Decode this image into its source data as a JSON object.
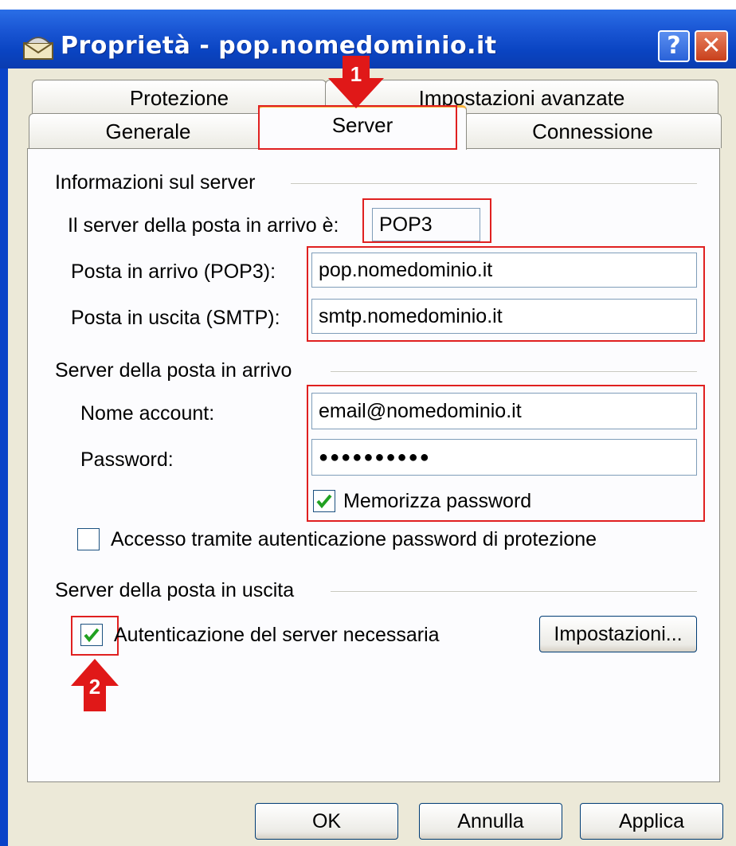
{
  "window": {
    "title": "Proprietà - pop.nomedominio.it",
    "help_label": "?",
    "close_label": "✕"
  },
  "tabs": {
    "protezione": "Protezione",
    "avanzate": "Impostazioni avanzate",
    "generale": "Generale",
    "server": "Server",
    "connessione": "Connessione"
  },
  "server_info": {
    "heading": "Informazioni sul server",
    "incoming_type_label": "Il server della posta in arrivo è:",
    "incoming_type_value": "POP3",
    "pop3_label": "Posta in arrivo (POP3):",
    "pop3_value": "pop.nomedominio.it",
    "smtp_label": "Posta in uscita (SMTP):",
    "smtp_value": "smtp.nomedominio.it"
  },
  "incoming": {
    "heading": "Server della posta in arrivo",
    "account_label": "Nome account:",
    "account_value": "email@nomedominio.it",
    "password_label": "Password:",
    "password_value": "●●●●●●●●●●",
    "remember_label": "Memorizza password",
    "remember_checked": true,
    "spa_label": "Accesso tramite autenticazione password di protezione",
    "spa_checked": false
  },
  "outgoing": {
    "heading": "Server della posta in uscita",
    "auth_label": "Autenticazione del server necessaria",
    "auth_checked": true,
    "settings_button": "Impostazioni..."
  },
  "buttons": {
    "ok": "OK",
    "cancel": "Annulla",
    "apply": "Applica"
  },
  "annotations": {
    "marker1": "1",
    "marker2": "2"
  },
  "colors": {
    "highlight": "#e02020",
    "arrow": "#e01818",
    "titlebar": "#0a44c2",
    "dialog": "#ece9d8"
  }
}
